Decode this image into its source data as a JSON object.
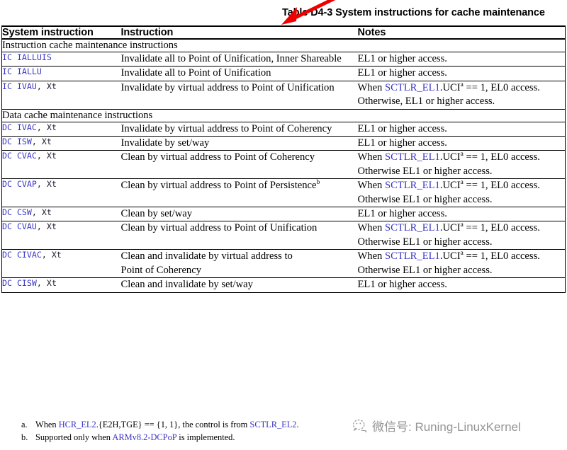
{
  "title": {
    "text": "Table D4-3 System instructions for cache maintenance"
  },
  "annotation": {
    "arrow_color": "#ee0000",
    "arrow_name": "red-arrow-pointing-at-title"
  },
  "table": {
    "columns": [
      "System instruction",
      "Instruction",
      "Notes"
    ],
    "sections": [
      {
        "heading": "Instruction cache maintenance instructions",
        "rows": [
          {
            "sys_op": "IC",
            "sys_arg": "IALLUIS",
            "sys_reg": "",
            "instruction": "Invalidate all to Point of Unification, Inner Shareable",
            "note_lines": [
              [
                {
                  "t": "EL1 or higher access.",
                  "style": "plain"
                }
              ]
            ]
          },
          {
            "sys_op": "IC",
            "sys_arg": "IALLU",
            "sys_reg": "",
            "instruction": "Invalidate all to Point of Unification",
            "note_lines": [
              [
                {
                  "t": "EL1 or higher access.",
                  "style": "plain"
                }
              ]
            ]
          },
          {
            "sys_op": "IC",
            "sys_arg": "IVAU",
            "sys_reg": ", Xt",
            "instruction": "Invalidate by virtual address to Point of Unification",
            "note_lines": [
              [
                {
                  "t": "When ",
                  "style": "plain"
                },
                {
                  "t": "SCTLR_EL1",
                  "style": "reg"
                },
                {
                  "t": ".UCI",
                  "style": "plain"
                },
                {
                  "t": "a",
                  "style": "sup"
                },
                {
                  "t": " == 1, EL0 access.",
                  "style": "plain"
                }
              ],
              [
                {
                  "t": "Otherwise, EL1 or higher access.",
                  "style": "plain"
                }
              ]
            ]
          }
        ]
      },
      {
        "heading": "Data cache maintenance instructions",
        "rows": [
          {
            "sys_op": "DC",
            "sys_arg": "IVAC",
            "sys_reg": ", Xt",
            "instruction": "Invalidate by virtual address to Point of Coherency",
            "note_lines": [
              [
                {
                  "t": "EL1 or higher access.",
                  "style": "plain"
                }
              ]
            ]
          },
          {
            "sys_op": "DC",
            "sys_arg": "ISW",
            "sys_reg": ", Xt",
            "instruction": "Invalidate by set/way",
            "note_lines": [
              [
                {
                  "t": "EL1 or higher access.",
                  "style": "plain"
                }
              ]
            ]
          },
          {
            "sys_op": "DC",
            "sys_arg": "CVAC",
            "sys_reg": ", Xt",
            "instruction": "Clean by virtual address to Point of Coherency",
            "note_lines": [
              [
                {
                  "t": "When ",
                  "style": "plain"
                },
                {
                  "t": "SCTLR_EL1",
                  "style": "reg"
                },
                {
                  "t": ".UCI",
                  "style": "plain"
                },
                {
                  "t": "a",
                  "style": "sup"
                },
                {
                  "t": " == 1, EL0 access.",
                  "style": "plain"
                }
              ],
              [
                {
                  "t": "Otherwise EL1 or higher access.",
                  "style": "plain"
                }
              ]
            ]
          },
          {
            "sys_op": "DC",
            "sys_arg": "CVAP",
            "sys_reg": ", Xt",
            "instruction": "Clean by virtual address to Point of Persistence",
            "instruction_sup": "b",
            "note_lines": [
              [
                {
                  "t": "When ",
                  "style": "plain"
                },
                {
                  "t": "SCTLR_EL1",
                  "style": "reg"
                },
                {
                  "t": ".UCI",
                  "style": "plain"
                },
                {
                  "t": "a",
                  "style": "sup"
                },
                {
                  "t": " == 1, EL0 access.",
                  "style": "plain"
                }
              ],
              [
                {
                  "t": "Otherwise EL1 or higher access.",
                  "style": "plain"
                }
              ]
            ]
          },
          {
            "sys_op": "DC",
            "sys_arg": "CSW",
            "sys_reg": ", Xt",
            "instruction": "Clean by set/way",
            "note_lines": [
              [
                {
                  "t": "EL1 or higher access.",
                  "style": "plain"
                }
              ]
            ]
          },
          {
            "sys_op": "DC",
            "sys_arg": "CVAU",
            "sys_reg": ", Xt",
            "instruction": "Clean by virtual address to Point of Unification",
            "note_lines": [
              [
                {
                  "t": "When ",
                  "style": "plain"
                },
                {
                  "t": "SCTLR_EL1",
                  "style": "reg"
                },
                {
                  "t": ".UCI",
                  "style": "plain"
                },
                {
                  "t": "a",
                  "style": "sup"
                },
                {
                  "t": " == 1, EL0 access.",
                  "style": "plain"
                }
              ],
              [
                {
                  "t": "Otherwise EL1 or higher access.",
                  "style": "plain"
                }
              ]
            ]
          },
          {
            "sys_op": "DC",
            "sys_arg": "CIVAC",
            "sys_reg": ", Xt",
            "instruction": "Clean and invalidate by virtual address to",
            "instruction_line2": "Point of Coherency",
            "note_lines": [
              [
                {
                  "t": "When ",
                  "style": "plain"
                },
                {
                  "t": "SCTLR_EL1",
                  "style": "reg"
                },
                {
                  "t": ".UCI",
                  "style": "plain"
                },
                {
                  "t": "a",
                  "style": "sup"
                },
                {
                  "t": " == 1, EL0 access.",
                  "style": "plain"
                }
              ],
              [
                {
                  "t": "Otherwise EL1 or higher access.",
                  "style": "plain"
                }
              ]
            ]
          },
          {
            "sys_op": "DC",
            "sys_arg": "CISW",
            "sys_reg": ", Xt",
            "instruction": "Clean and invalidate by set/way",
            "note_lines": [
              [
                {
                  "t": "EL1 or higher access.",
                  "style": "plain"
                }
              ]
            ]
          }
        ]
      }
    ]
  },
  "footnotes": [
    {
      "marker": "a.",
      "parts": [
        {
          "t": "When ",
          "style": "plain"
        },
        {
          "t": "HCR_EL2",
          "style": "reg"
        },
        {
          "t": ".{E2H,TGE} == {1, 1}, the control is from ",
          "style": "plain"
        },
        {
          "t": "SCTLR_EL2",
          "style": "reg"
        },
        {
          "t": ".",
          "style": "plain"
        }
      ]
    },
    {
      "marker": "b.",
      "parts": [
        {
          "t": "Supported only when ",
          "style": "plain"
        },
        {
          "t": "ARMv8.2-DCPoP",
          "style": "reg"
        },
        {
          "t": " is implemented.",
          "style": "plain"
        }
      ]
    }
  ],
  "watermark": {
    "text": "微信号: Runing-LinuxKernel",
    "color": "#8f8f8f"
  },
  "colors": {
    "register_blue": "#3a36c4",
    "mono_blue": "#3a36c4",
    "arrow_red": "#ee0000",
    "rule_black": "#000000"
  }
}
